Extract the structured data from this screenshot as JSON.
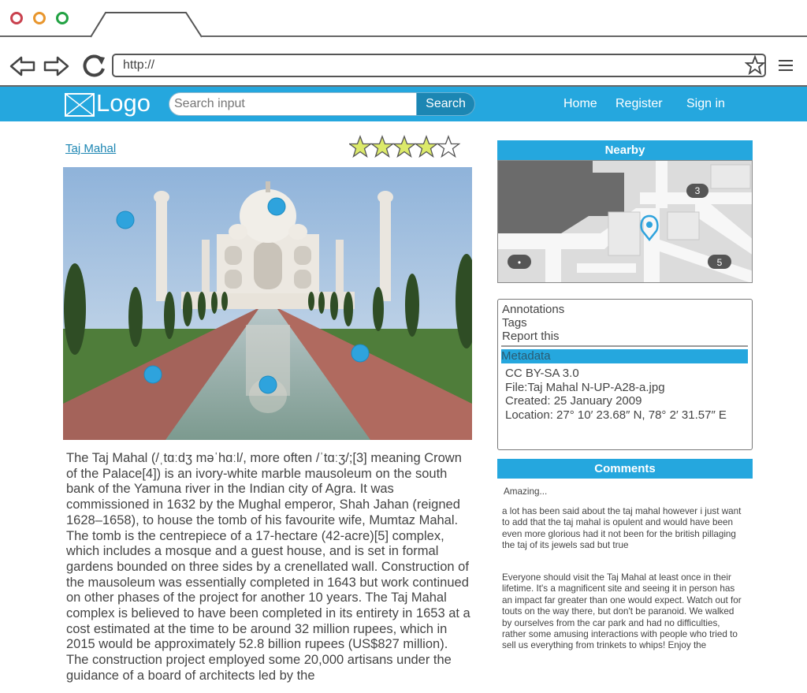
{
  "browser": {
    "url": "http://",
    "window_buttons": [
      "close-red",
      "minimize-orange",
      "maximize-green"
    ],
    "colors": {
      "close": "#c9414e",
      "minimize": "#e8962d",
      "maximize": "#22a243"
    }
  },
  "header": {
    "logo_text": "Logo",
    "search_placeholder": "Search input",
    "search_button": "Search",
    "nav": [
      "Home",
      "Register",
      "Sign in"
    ],
    "accent_color": "#25a7de"
  },
  "main": {
    "title": "Taj Mahal",
    "rating": {
      "value": 4,
      "max": 5
    },
    "body": "The Taj Mahal (/ˌtɑːdʒ məˈhɑːl/, more often /ˈtɑːʒ/;[3] meaning Crown of the Palace[4]) is an ivory-white marble mausoleum on the south bank of the Yamuna river in the Indian city of Agra. It was commissioned in 1632 by the Mughal emperor, Shah Jahan (reigned 1628–1658), to house the tomb of his favourite wife, Mumtaz Mahal. The tomb is the centrepiece of a 17-hectare (42-acre)[5] complex, which includes a mosque and a guest house, and is set in formal gardens bounded on three sides by a crenellated wall. Construction of the mausoleum was essentially completed in 1643 but work continued on other phases of the project for another 10 years. The Taj Mahal complex is believed to have been completed in its entirety in 1653 at a cost estimated at the time to be around 32 million rupees, which in 2015 would be approximately 52.8 billion rupees (US$827 million). The construction project employed some 20,000 artisans under the guidance of a board of architects led by the"
  },
  "sidebar": {
    "nearby_title": "Nearby",
    "map_badges": [
      "3",
      "5",
      "•"
    ],
    "links": [
      "Annotations",
      "Tags",
      "Report this"
    ],
    "metadata_title": "Metadata",
    "metadata": [
      "CC BY-SA 3.0",
      "File:Taj Mahal N-UP-A28-a.jpg",
      "Created: 25 January 2009",
      "Location: 27° 10′ 23.68″ N, 78° 2′ 31.57″ E"
    ],
    "comments_title": "Comments",
    "comments": [
      "Amazing...",
      "a lot has been said about the taj mahal however i just want to add that the taj mahal is opulent and would have been even more glorious had it not been for the british pillaging the taj of its jewels sad but true",
      "Everyone should visit the Taj Mahal at least once in their lifetime. It's a magnificent site and seeing it in person has an impact far greater than one would expect. Watch out for touts on the way there, but don't be paranoid. We walked by ourselves from the car park and had no difficulties, rather some amusing interactions with people who tried to sell us everything from trinkets to whips! Enjoy the"
    ]
  }
}
